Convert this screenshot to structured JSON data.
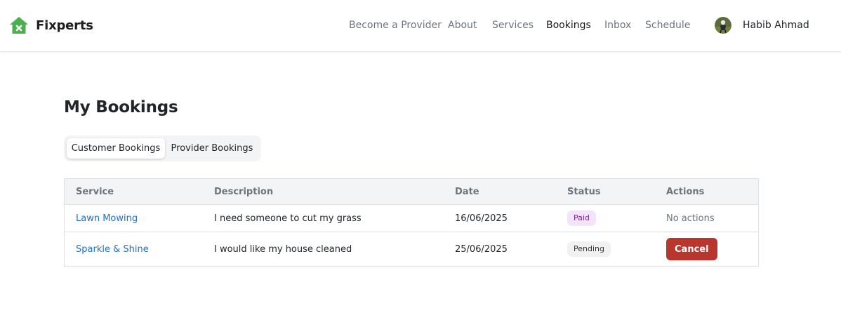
{
  "app": {
    "brand_name": "Fixperts",
    "brand_color": "#4caf50"
  },
  "nav": {
    "items": [
      {
        "label": "Become a Provider",
        "active": false
      },
      {
        "label": "About",
        "active": false
      },
      {
        "label": "Services",
        "active": false
      },
      {
        "label": "Bookings",
        "active": true
      },
      {
        "label": "Inbox",
        "active": false
      },
      {
        "label": "Schedule",
        "active": false
      }
    ]
  },
  "user": {
    "name": "Habib Ahmad",
    "avatar_icon": "user-avatar"
  },
  "page": {
    "title": "My Bookings"
  },
  "tabs": [
    {
      "label": "Customer Bookings",
      "active": true
    },
    {
      "label": "Provider Bookings",
      "active": false
    }
  ],
  "table": {
    "columns": [
      "Service",
      "Description",
      "Date",
      "Status",
      "Actions"
    ],
    "rows": [
      {
        "service": "Lawn Mowing",
        "description": "I need someone to cut my grass",
        "date": "16/06/2025",
        "status": "Paid",
        "action": "No actions"
      },
      {
        "service": "Sparkle & Shine",
        "description": "I would like my house cleaned",
        "date": "25/06/2025",
        "status": "Pending",
        "action": "Cancel"
      }
    ]
  },
  "colors": {
    "link": "#1f6fd1",
    "cancel_button": "#b7372e",
    "paid_badge_bg": "#f3e3fb",
    "paid_badge_text": "#7a1fa2",
    "pending_badge_bg": "#f1f1f1"
  }
}
